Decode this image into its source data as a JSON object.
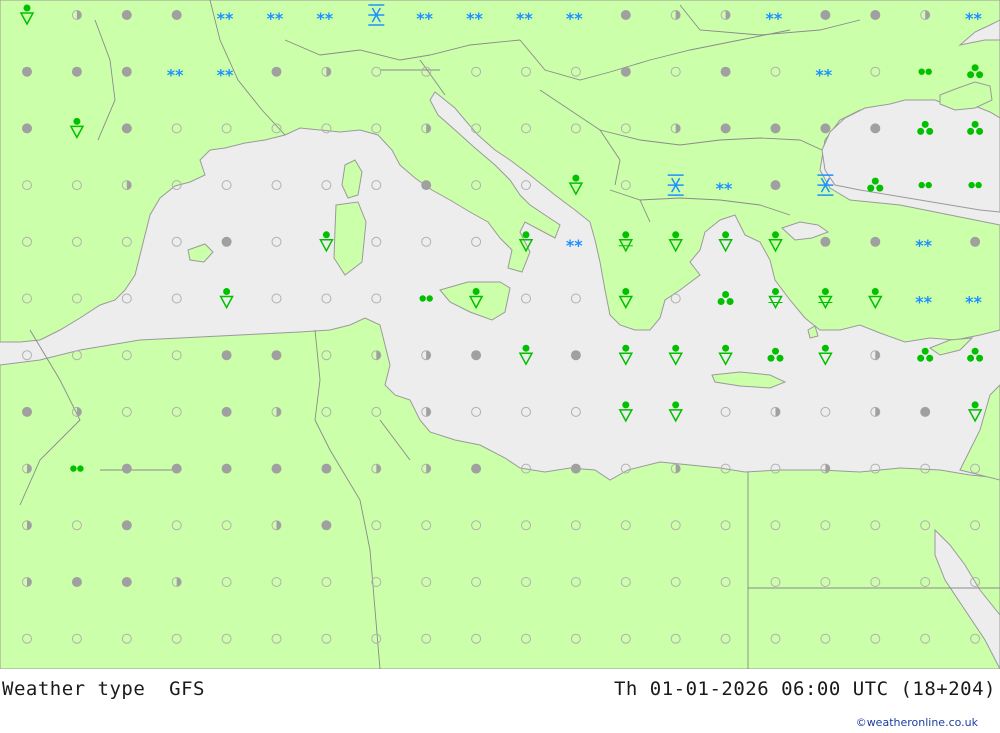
{
  "map": {
    "colors": {
      "land": "#ccffaa",
      "sea": "#ededed",
      "border": "#8a8a8a",
      "coast": "#9a9a9a",
      "snow": "#1e90ff",
      "rain": "#00c000",
      "cloud": "#a0a0a0",
      "clear": "#a8a8a8"
    },
    "cols": 20,
    "rows": 12,
    "legend_symbols": [
      "filled-circle",
      "half-circle",
      "open-circle",
      "snow-flakes",
      "heavy-snow",
      "rain-shower",
      "light-rain",
      "rain-drops"
    ],
    "grid": [
      "RhFFSSSXSSSSFhhSFFhS",
      "FFFSSFhOOOOOFOFOSOdt",
      "FRFOOOOOhOOOOhFFFFtt",
      "OOhOOOOOFOOROXSFXtdd",
      "OOOOFOROOORSrRRRFFSF",
      "OOOOROOOdROOROtrrRSS",
      "OOOOFFOhhFRFRRRtRhtt",
      "FhOOFhOOhOOORROhOhFR",
      "hdFFFFFhhFOFOhOOhOOO",
      "hOFOOhFOOOOOOOOOOOOO",
      "hFFhOOOOOOOOOOOOOOOO",
      "OOOOOOOOOOOOOOOOOOOO"
    ]
  },
  "footer": {
    "left": "Weather type  GFS",
    "right": "Th 01-01-2026 06:00 UTC (18+204)",
    "credit": "©weatheronline.co.uk"
  }
}
